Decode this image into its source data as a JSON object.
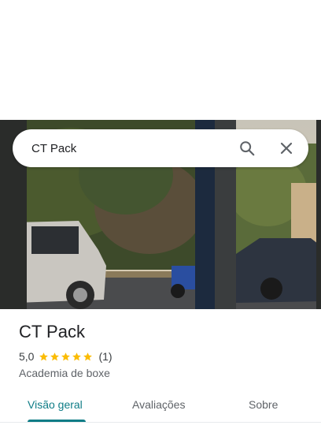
{
  "search": {
    "query": "CT Pack"
  },
  "place": {
    "title": "CT Pack",
    "rating": "5,0",
    "stars": 5,
    "review_count": "(1)",
    "category": "Academia de boxe"
  },
  "tabs": [
    {
      "label": "Visão geral",
      "active": true
    },
    {
      "label": "Avaliações",
      "active": false
    },
    {
      "label": "Sobre",
      "active": false
    }
  ],
  "colors": {
    "accent": "#0e7c86",
    "star": "#fbbc04"
  },
  "icons": [
    "search-icon",
    "close-icon",
    "star-icon"
  ]
}
